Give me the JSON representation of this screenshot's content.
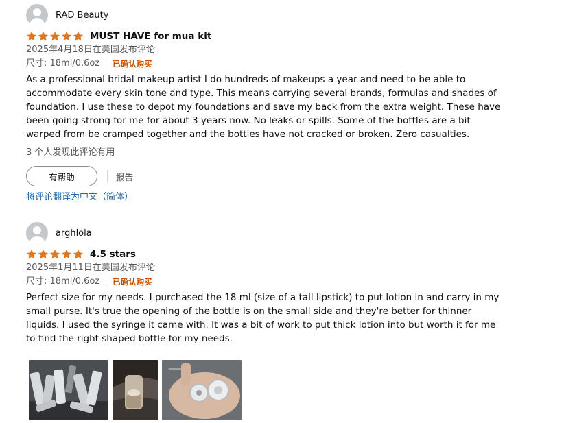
{
  "reviews": [
    {
      "reviewer": "RAD Beauty",
      "rating": 5,
      "title": "MUST HAVE for mua kit",
      "date_text": "2025年4月18日在美国发布评论",
      "size": "尺寸: 18ml/0.6oz",
      "verified": "已确认购买",
      "body": "As a professional bridal makeup artist I do hundreds of makeups a year and need to be able to accommodate every skin tone and type. This means carrying several brands, formulas and shades of foundation. I use these to depot my foundations and save my back from the extra weight. These have been going strong for me for about 3 years now. No leaks or spills. Some of the bottles are a bit warped from be cramped together and the bottles have not cracked or broken. Zero casualties.",
      "helpful_count": "3 个人发现此评论有用",
      "helpful_button": "有帮助",
      "report": "报告",
      "translate": "将评论翻译为中文（简体）"
    },
    {
      "reviewer": "arghlola",
      "rating": 5,
      "title": "4.5 stars",
      "date_text": "2025年1月11日在美国发布评论",
      "size": "尺寸: 18ml/0.6oz",
      "verified": "已确认购买",
      "body": "Perfect size for my needs. I purchased the 18 ml (size of a tall lipstick) to put lotion in and carry in my small purse. It's true the opening of the bottle is on the small side and they're better for thinner liquids. I used the syringe it came with. It was a bit of work to put thick lotion into but worth it for me to find the right shaped bottle for my needs.",
      "images": [
        "review-photo-bottles-bag",
        "review-photo-bottle-in-purse",
        "review-photo-caps-in-hand"
      ]
    }
  ],
  "colors": {
    "star": "#de7921",
    "verified": "#c45500",
    "link": "#2162a1",
    "muted": "#565959"
  },
  "icons": [
    "avatar-icon",
    "star-icon"
  ]
}
